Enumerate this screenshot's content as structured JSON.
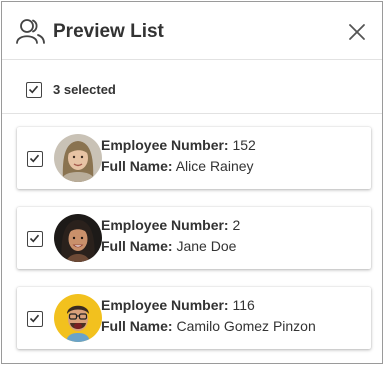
{
  "header": {
    "title": "Preview List",
    "icon": "users-icon",
    "close_icon": "close-icon"
  },
  "selection": {
    "count_label": "3 selected",
    "checked": true
  },
  "field_labels": {
    "employee_number": "Employee Number:",
    "full_name": "Full Name:"
  },
  "employees": [
    {
      "employee_number": "152",
      "full_name": "Alice Rainey",
      "checked": true,
      "avatar": "avatar-alice"
    },
    {
      "employee_number": "2",
      "full_name": "Jane Doe",
      "checked": true,
      "avatar": "avatar-jane"
    },
    {
      "employee_number": "116",
      "full_name": "Camilo Gomez Pinzon",
      "checked": true,
      "avatar": "avatar-camilo"
    }
  ],
  "colors": {
    "border": "#9a9a9a",
    "text": "#333333",
    "avatar_yellow_bg": "#f2c11e"
  }
}
